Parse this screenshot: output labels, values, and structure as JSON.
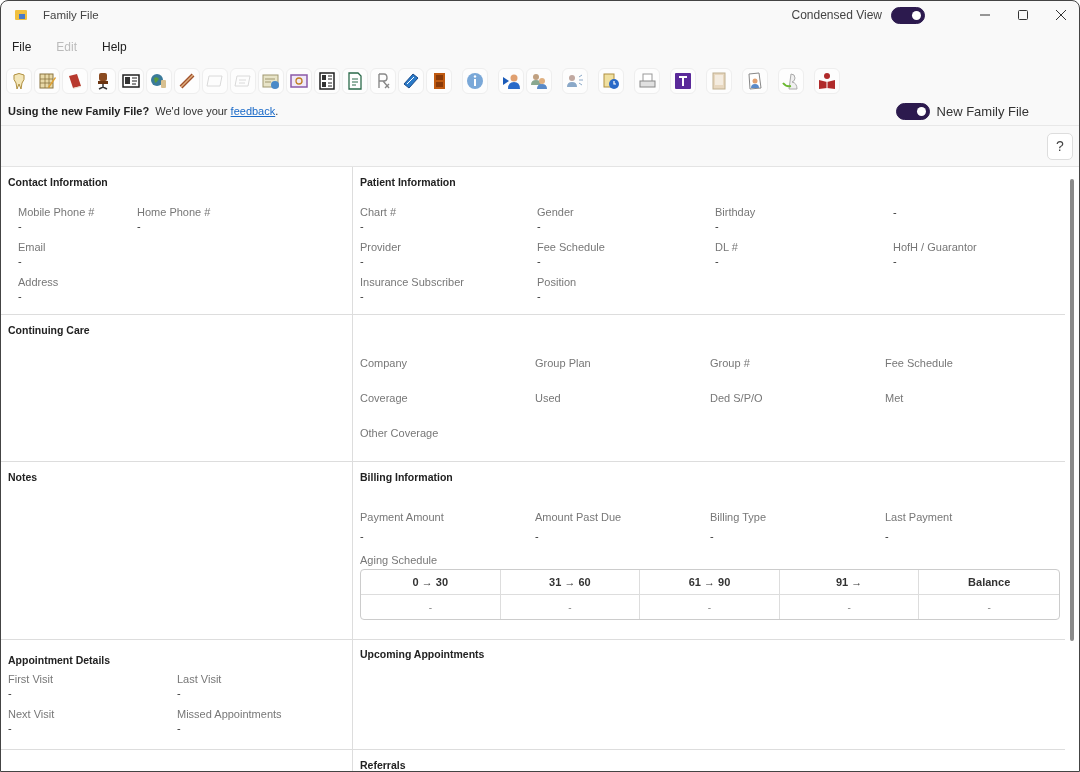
{
  "window": {
    "title": "Family File"
  },
  "condensed_view": {
    "label": "Condensed View",
    "on": true
  },
  "menu": [
    {
      "label": "File",
      "disabled": false
    },
    {
      "label": "Edit",
      "disabled": true
    },
    {
      "label": "Help",
      "disabled": false
    }
  ],
  "toolbar": [
    {
      "buttons": [
        {
          "disabled": false
        },
        {
          "disabled": false
        },
        {
          "disabled": false
        },
        {
          "disabled": false
        },
        {
          "disabled": false
        },
        {
          "disabled": false
        },
        {
          "disabled": false
        },
        {
          "disabled": true
        },
        {
          "disabled": true
        },
        {
          "disabled": false
        },
        {
          "disabled": false
        },
        {
          "disabled": false
        },
        {
          "disabled": false
        },
        {
          "disabled": false
        },
        {
          "disabled": false
        },
        {
          "disabled": false
        }
      ]
    },
    {
      "buttons": [
        {
          "disabled": false
        }
      ]
    },
    {
      "buttons": [
        {
          "disabled": false
        },
        {
          "disabled": false
        }
      ]
    },
    {
      "buttons": [
        {
          "disabled": false
        }
      ]
    },
    {
      "buttons": [
        {
          "disabled": false
        }
      ]
    },
    {
      "buttons": [
        {
          "disabled": false
        }
      ]
    },
    {
      "buttons": [
        {
          "disabled": false
        }
      ]
    },
    {
      "buttons": [
        {
          "disabled": false
        }
      ]
    },
    {
      "buttons": [
        {
          "disabled": false
        }
      ]
    },
    {
      "buttons": [
        {
          "disabled": false
        }
      ]
    },
    {
      "buttons": [
        {
          "disabled": false
        }
      ]
    }
  ],
  "feedback": {
    "question": "Using the new Family File?",
    "text": "We'd love your",
    "link": "feedback",
    "end": "."
  },
  "new_family_file": {
    "label": "New Family File",
    "on": true
  },
  "help_button": "?",
  "contact_information": {
    "title": "Contact Information",
    "rows": [
      [
        {
          "label": "Mobile Phone #",
          "value": "-"
        },
        {
          "label": "Home Phone #",
          "value": "-"
        }
      ],
      [
        {
          "label": "Email",
          "value": "-"
        }
      ],
      [
        {
          "label": "Address",
          "value": "-"
        }
      ]
    ]
  },
  "patient_information": {
    "title": "Patient Information",
    "rows": [
      [
        {
          "label": "Chart #",
          "value": "-"
        },
        {
          "label": "Gender",
          "value": "-"
        },
        {
          "label": "Birthday",
          "value": "-"
        },
        {
          "value": "-"
        }
      ],
      [
        {
          "label": "Provider",
          "value": "-"
        },
        {
          "label": "Fee Schedule",
          "value": "-"
        },
        {
          "label": "DL #",
          "value": "-"
        },
        {
          "label": "HofH / Guarantor",
          "value": "-"
        }
      ],
      [
        {
          "label": "Insurance Subscriber",
          "value": "-"
        },
        {
          "label": "Position",
          "value": "-"
        }
      ]
    ]
  },
  "continuing_care": {
    "title": "Continuing Care"
  },
  "insurance": {
    "rows": [
      [
        {
          "label": "Company"
        },
        {
          "label": "Group Plan"
        },
        {
          "label": "Group #"
        },
        {
          "label": "Fee Schedule"
        }
      ],
      [
        {
          "label": "Coverage"
        },
        {
          "label": "Used"
        },
        {
          "label": "Ded S/P/O"
        },
        {
          "label": "Met"
        }
      ],
      [
        {
          "label": "Other Coverage"
        }
      ]
    ]
  },
  "notes": {
    "title": "Notes"
  },
  "billing_information": {
    "title": "Billing Information",
    "fields": [
      {
        "label": "Payment Amount",
        "value": "-"
      },
      {
        "label": "Amount Past Due",
        "value": "-"
      },
      {
        "label": "Billing Type",
        "value": "-"
      },
      {
        "label": "Last Payment",
        "value": "-"
      }
    ],
    "aging_schedule": {
      "label": "Aging Schedule",
      "columns": [
        "0 → 30",
        "31 → 60",
        "61 → 90",
        "91 →",
        "Balance"
      ],
      "values": [
        "-",
        "-",
        "-",
        "-",
        "-"
      ]
    }
  },
  "appointment_details": {
    "title": "Appointment Details",
    "rows": [
      [
        {
          "label": "First Visit",
          "value": "-"
        },
        {
          "label": "Last Visit",
          "value": "-"
        }
      ],
      [
        {
          "label": "Next Visit",
          "value": "-"
        },
        {
          "label": "Missed Appointments",
          "value": "-"
        }
      ]
    ]
  },
  "upcoming_appointments": {
    "title": "Upcoming Appointments"
  },
  "referrals": {
    "title": "Referrals"
  }
}
